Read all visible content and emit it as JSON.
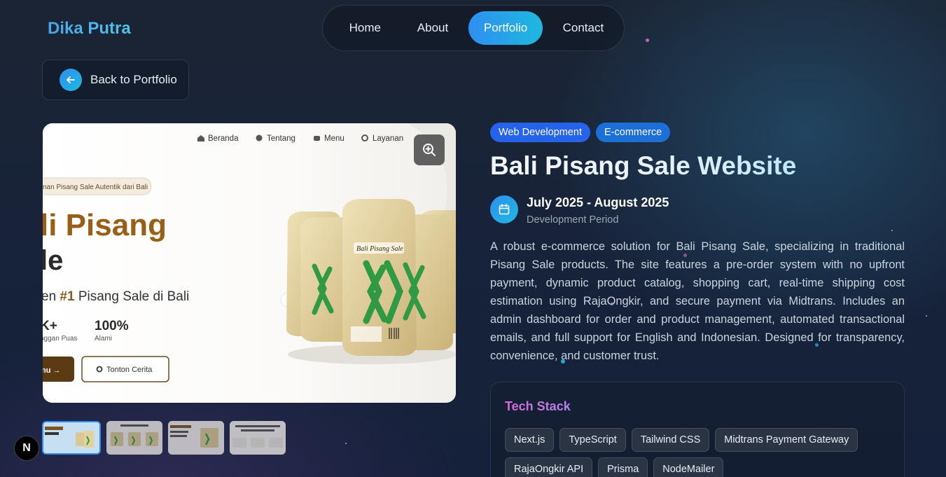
{
  "header": {
    "logo": "Dika Putra"
  },
  "nav": {
    "items": [
      "Home",
      "About",
      "Portfolio",
      "Contact"
    ],
    "active": "Portfolio"
  },
  "back_button": {
    "label": "Back to Portfolio"
  },
  "gallery": {
    "thumbnail_count": 4,
    "active_index": 0,
    "preview": {
      "nav_links": [
        "Beranda",
        "Tentang",
        "Menu",
        "Layanan"
      ],
      "badge": "nan Pisang Sale Autentik dari Bali",
      "heading_line1": "li Pisang",
      "heading_line2": "le",
      "tagline_pre": "en ",
      "tagline_highlight": "#1",
      "tagline_post": " Pisang Sale di Bali",
      "stat1_value": "K+",
      "stat1_label": "nggan Puas",
      "stat2_value": "100%",
      "stat2_label": "Alami",
      "btn_primary": "nu →",
      "btn_secondary": "Tonton Cerita",
      "package_label": "Bali Pisang Sale"
    }
  },
  "project": {
    "tags": [
      "Web Development",
      "E-commerce"
    ],
    "title": "Bali Pisang Sale Website",
    "date": "July 2025 - August 2025",
    "date_label": "Development Period",
    "description": "A robust e-commerce solution for Bali Pisang Sale, specializing in traditional Pisang Sale products. The site features a pre-order system with no upfront payment, dynamic product catalog, shopping cart, real-time shipping cost estimation using RajaOngkir, and secure payment via Midtrans. Includes an admin dashboard for order and product management, automated transactional emails, and full support for English and Indonesian. Designed for transparency, convenience, and customer trust."
  },
  "tech_stack": {
    "title": "Tech Stack",
    "items": [
      "Next.js",
      "TypeScript",
      "Tailwind CSS",
      "Midtrans Payment Gateway",
      "RajaOngkir API",
      "Prisma",
      "NodeMailer"
    ]
  },
  "dev_badge": {
    "label": "N"
  },
  "colors": {
    "accent": "#2f8ff0",
    "accent2": "#1fb8e0",
    "brand_brown": "#8a5a1c"
  }
}
